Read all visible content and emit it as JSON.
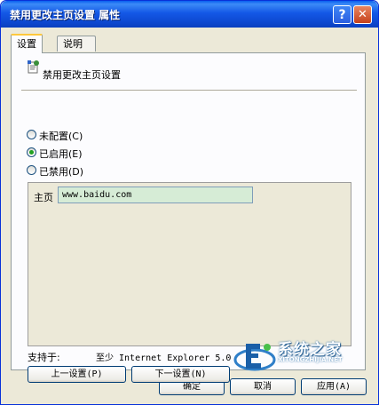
{
  "window": {
    "title": "禁用更改主页设置 属性",
    "help_glyph": "?",
    "close_glyph": "✕"
  },
  "tabs": [
    {
      "label": "设置",
      "active": true
    },
    {
      "label": "说明",
      "active": false
    }
  ],
  "policy": {
    "icon": "policy-setting-icon",
    "title": "禁用更改主页设置"
  },
  "options": [
    {
      "label": "未配置(C)",
      "checked": false
    },
    {
      "label": "已启用(E)",
      "checked": true
    },
    {
      "label": "已禁用(D)",
      "checked": false
    }
  ],
  "home": {
    "label": "主页",
    "value": "www.baidu.com"
  },
  "supported": {
    "label": "支持于:",
    "value": "至少 Internet Explorer 5.0"
  },
  "buttons": {
    "prev": "上一设置(P)",
    "next": "下一设置(N)",
    "ok": "确定",
    "cancel": "取消",
    "apply": "应用(A)"
  },
  "watermark": {
    "text": "系统之家",
    "sub": "XITONGZHIJIA.NET"
  },
  "colors": {
    "titlebar": "#0a5fef",
    "dialog_bg": "#ece9d8",
    "input_bg": "#d6ecd6",
    "radio_dot": "#21a121"
  }
}
